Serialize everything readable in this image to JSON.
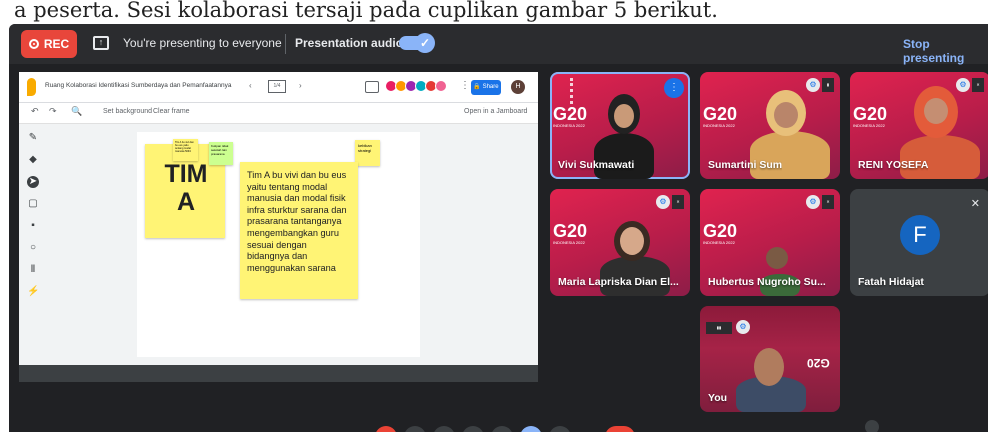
{
  "document": {
    "caption_line": "a peserta. Sesi kolaborasi tersaji pada cuplikan gambar 5 berikut."
  },
  "topbar": {
    "rec_label": "REC",
    "presenting_text": "You're presenting to everyone",
    "audio_label": "Presentation audio",
    "audio_on": true,
    "stop_label": "Stop presenting"
  },
  "jamboard": {
    "title": "Ruang Kolaborasi Identifikasi Sumberdaya dan Pemanfaatannya",
    "frame_counter": "1/4",
    "share_label": "Share",
    "avatar_initial": "H",
    "set_background": "Set background",
    "clear_frame": "Clear frame",
    "open_jamboard": "Open in a Jamboard",
    "notes": {
      "team_big": "TIM A",
      "small_yellow": "Tim A bu vivi dan bu eus yaitu tentang modal manusia 5094",
      "small_green": "Kutipan tidak sekolah lain prasarana",
      "strategy": "kebikan strategi",
      "main": "Tim A bu vivi dan bu eus yaitu tentang modal manusia dan modal fisik infra sturktur sarana dan prasarana tantanganya mengembangkan guru sesuai dengan bidangnya dan menggunakan sarana"
    }
  },
  "participants": [
    {
      "name": "Vivi Sukmawati"
    },
    {
      "name": "Sumartini Sum"
    },
    {
      "name": "RENI YOSEFA"
    },
    {
      "name": "Maria Lapriska Dian El..."
    },
    {
      "name": "Hubertus Nugroho Su..."
    },
    {
      "name": "Fatah Hidajat",
      "initial": "F"
    },
    {
      "name": "You"
    }
  ],
  "colors": {
    "rec": "#e8463b",
    "accent": "#8ab4f8",
    "meet_bg": "#202124",
    "g20_red": "#e0234f",
    "note_yellow": "#fff475",
    "note_green": "#ccff90"
  }
}
